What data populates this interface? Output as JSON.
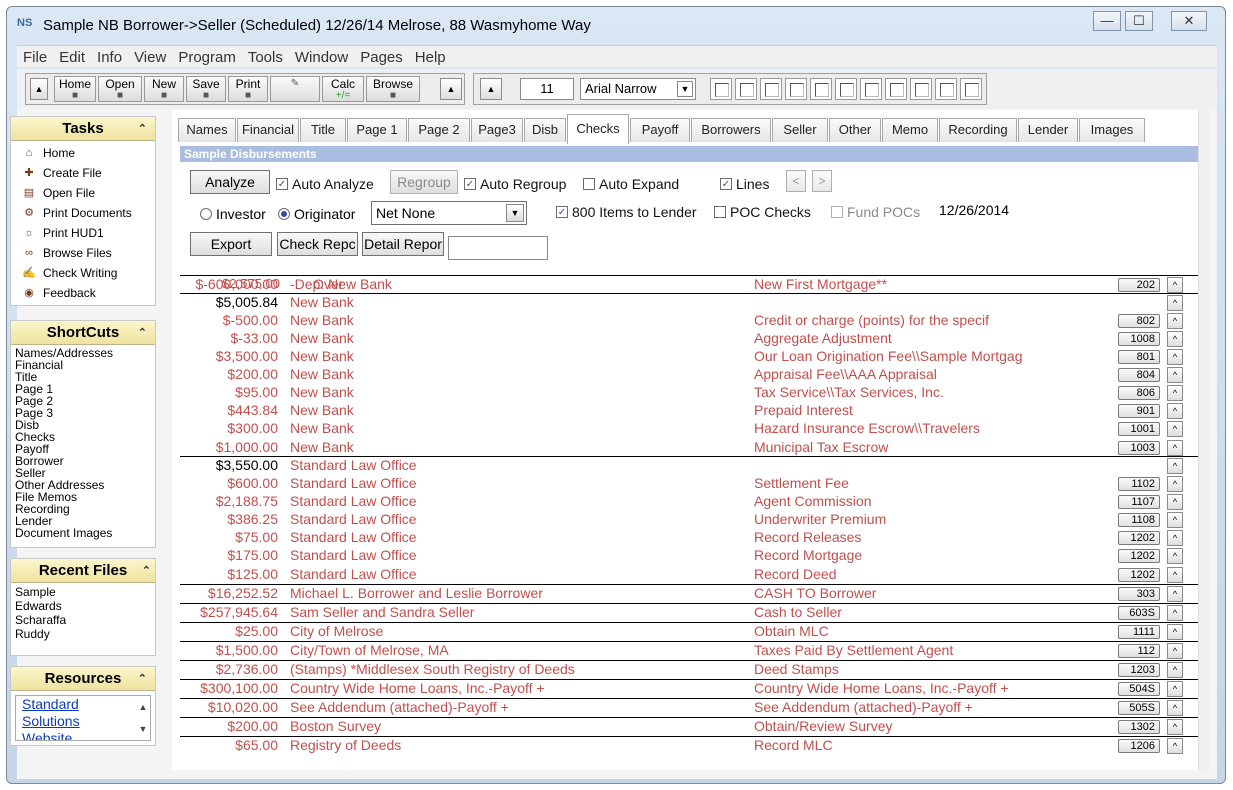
{
  "window": {
    "title": "Sample NB Borrower->Seller (Scheduled) 12/26/14 Melrose, 88 Wasmyhome Way",
    "app_icon": "NS",
    "minimize": "—",
    "maximize": "☐",
    "close": "✕"
  },
  "menu": [
    "File",
    "Edit",
    "Info",
    "View",
    "Program",
    "Tools",
    "Window",
    "Pages",
    "Help"
  ],
  "toolbar": {
    "buttons": [
      "Home",
      "Open",
      "New",
      "Save",
      "Print",
      "",
      "Calc",
      "Browse"
    ],
    "calc_sub": "+/=",
    "font_size": "11",
    "font_name": "Arial Narrow"
  },
  "tasks": {
    "title": "Tasks",
    "items": [
      "Home",
      "Create File",
      "Open File",
      "Print Documents",
      "Print HUD1",
      "Browse Files",
      "Check Writing",
      "Feedback"
    ]
  },
  "shortcuts": {
    "title": "ShortCuts",
    "items": [
      "Names/Addresses",
      "Financial",
      "Title",
      "Page 1",
      "Page 2",
      "Page 3",
      "Disb",
      "Checks",
      "Payoff",
      "Borrower",
      "Seller",
      "Other Addresses",
      "File Memos",
      "Recording",
      "Lender",
      "Document Images"
    ]
  },
  "recent_files": {
    "title": "Recent Files",
    "items": [
      "Sample",
      "Edwards",
      "Scharaffa",
      "Ruddy"
    ]
  },
  "resources": {
    "title": "Resources",
    "link_lines": [
      "Standard",
      "Solutions",
      "Website"
    ]
  },
  "tabs": [
    "Names",
    "Financial",
    "Title",
    "Page 1",
    "Page 2",
    "Page3",
    "Disb",
    "Checks",
    "Payoff",
    "Borrowers",
    "Seller",
    "Other",
    "Memo",
    "Recording",
    "Lender",
    "Images"
  ],
  "active_tab": "Checks",
  "section_title": "Sample Disbursements",
  "controls": {
    "analyze": "Analyze",
    "auto_analyze": "Auto Analyze",
    "regroup": "Regroup",
    "auto_regroup": "Auto Regroup",
    "auto_expand": "Auto Expand",
    "lines": "Lines",
    "prev": "<",
    "next": ">",
    "investor": "Investor",
    "originator": "Originator",
    "net_select": "Net None",
    "items_800": "800 Items to Lender",
    "poc_checks": "POC Checks",
    "fund_pocs": "Fund POCs",
    "date": "12/26/2014",
    "export": "Export",
    "check_report": "Check Repc",
    "detail_report": "Detail Repor"
  },
  "over_amount": "$2,575.00",
  "over_label": "Over",
  "rows": [
    {
      "amt": "$-600,000.00",
      "payee": "-Dep: New Bank",
      "desc": "New First Mortgage**",
      "line": "202"
    },
    {
      "amt": "$5,005.84",
      "payee": "New Bank",
      "desc": "",
      "line": "",
      "total": true
    },
    {
      "amt": "$-500.00",
      "payee": "New Bank",
      "desc": "Credit or charge (points) for the specif",
      "line": "802"
    },
    {
      "amt": "$-33.00",
      "payee": "New Bank",
      "desc": "Aggregate Adjustment",
      "line": "1008"
    },
    {
      "amt": "$3,500.00",
      "payee": "New Bank",
      "desc": "Our Loan Origination Fee\\\\Sample Mortgag",
      "line": "801"
    },
    {
      "amt": "$200.00",
      "payee": "New Bank",
      "desc": "Appraisal Fee\\\\AAA Appraisal",
      "line": "804"
    },
    {
      "amt": "$95.00",
      "payee": "New Bank",
      "desc": "Tax Service\\\\Tax Services, Inc.",
      "line": "806"
    },
    {
      "amt": "$443.84",
      "payee": "New Bank",
      "desc": "Prepaid Interest",
      "line": "901"
    },
    {
      "amt": "$300.00",
      "payee": "New Bank",
      "desc": "Hazard Insurance Escrow\\\\Travelers",
      "line": "1001"
    },
    {
      "amt": "$1,000.00",
      "payee": "New Bank",
      "desc": "Municipal Tax Escrow",
      "line": "1003"
    },
    {
      "amt": "$3,550.00",
      "payee": "Standard Law Office",
      "desc": "",
      "line": "",
      "total": true
    },
    {
      "amt": "$600.00",
      "payee": "Standard Law Office",
      "desc": "Settlement Fee",
      "line": "1102"
    },
    {
      "amt": "$2,188.75",
      "payee": "Standard Law Office",
      "desc": "Agent Commission",
      "line": "1107"
    },
    {
      "amt": "$386.25",
      "payee": "Standard Law Office",
      "desc": "Underwriter Premium",
      "line": "1108"
    },
    {
      "amt": "$75.00",
      "payee": "Standard Law Office",
      "desc": "Record Releases",
      "line": "1202"
    },
    {
      "amt": "$175.00",
      "payee": "Standard Law Office",
      "desc": "Record Mortgage",
      "line": "1202"
    },
    {
      "amt": "$125.00",
      "payee": "Standard Law Office",
      "desc": "Record Deed",
      "line": "1202"
    },
    {
      "amt": "$16,252.52",
      "payee": "Michael L. Borrower and Leslie Borrower",
      "desc": "CASH TO Borrower",
      "line": "303"
    },
    {
      "amt": "$257,945.64",
      "payee": "Sam Seller and Sandra Seller",
      "desc": "Cash to Seller",
      "line": "603S"
    },
    {
      "amt": "$25.00",
      "payee": "City of Melrose",
      "desc": "Obtain MLC",
      "line": "1111"
    },
    {
      "amt": "$1,500.00",
      "payee": "City/Town of Melrose, MA",
      "desc": "Taxes Paid By Settlement Agent",
      "line": "112"
    },
    {
      "amt": "$2,736.00",
      "payee": "(Stamps) *Middlesex South Registry of Deeds",
      "desc": "Deed Stamps",
      "line": "1203"
    },
    {
      "amt": "$300,100.00",
      "payee": " Country Wide Home Loans, Inc.-Payoff +",
      "desc": " Country Wide Home Loans, Inc.-Payoff +",
      "line": "504S"
    },
    {
      "amt": "$10,020.00",
      "payee": " See Addendum (attached)-Payoff +",
      "desc": " See Addendum (attached)-Payoff +",
      "line": "505S"
    },
    {
      "amt": "$200.00",
      "payee": "Boston Survey",
      "desc": "Obtain/Review Survey",
      "line": "1302"
    },
    {
      "amt": "$65.00",
      "payee": "Registry of Deeds",
      "desc": "Record MLC",
      "line": "1206"
    }
  ]
}
